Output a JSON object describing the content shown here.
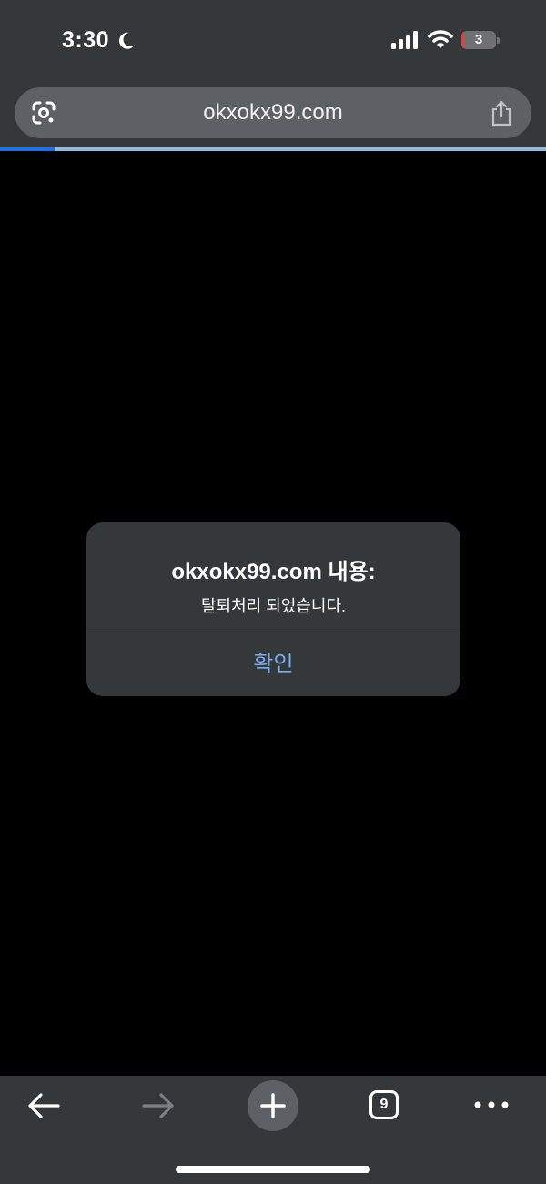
{
  "status_bar": {
    "time": "3:30",
    "battery_level": "3",
    "battery_fraction": 0.03,
    "icons": [
      "moon-icon",
      "cellular-signal-icon",
      "wifi-icon",
      "battery-icon"
    ]
  },
  "browser": {
    "url": "okxokx99.com",
    "load_progress": 0.1,
    "icons": {
      "lens": "google-lens-icon",
      "share": "share-icon"
    }
  },
  "alert": {
    "title": "okxokx99.com 내용:",
    "message": "탈퇴처리 되었습니다.",
    "confirm_label": "확인"
  },
  "toolbar": {
    "tab_count": "9",
    "icons": [
      "back-arrow-icon",
      "forward-arrow-icon",
      "plus-icon",
      "tab-switcher-icon",
      "more-dots-icon"
    ]
  },
  "colors": {
    "chrome_bg": "#35383b",
    "url_bar_bg": "#5d6064",
    "accent": "#78aef0",
    "progress": "#1a73e8",
    "battery_low": "#e0453a"
  }
}
